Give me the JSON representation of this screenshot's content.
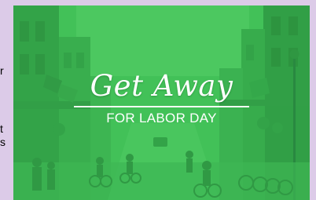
{
  "page": {
    "left_fragments": [
      "r",
      "t",
      "s"
    ]
  },
  "banner": {
    "headline": "Get Away",
    "subheadline": "FOR LABOR DAY",
    "overlay_color": "#3fbf55",
    "text_color": "#ffffff"
  }
}
